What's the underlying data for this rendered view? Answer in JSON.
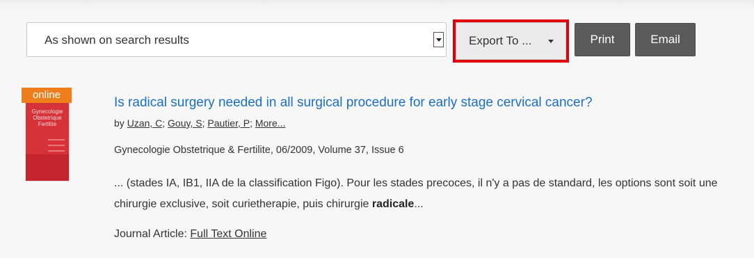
{
  "toolbar": {
    "select_value": "As shown on search results",
    "export_label": "Export To ...",
    "print_label": "Print",
    "email_label": "Email"
  },
  "result": {
    "badge": "online",
    "cover_text": "Gynecologie Obstetrique Fertilite",
    "title": "Is radical surgery needed in all surgical procedure for early stage cervical cancer?",
    "by": "by",
    "authors": [
      "Uzan, C",
      "Gouy, S",
      "Pautier, P",
      "More..."
    ],
    "publication": "Gynecologie Obstetrique & Fertilite, 06/2009, Volume 37, Issue 6",
    "snippet_text": "... (stades IA, IB1, IIA de la classification Figo). Pour les stades precoces, il n'y a pas de standard, les options sont soit une chirurgie exclusive, soit curietherapie, puis chirurgie ",
    "snippet_bold": "radicale",
    "snippet_end": "...",
    "type_label": "Journal Article:",
    "full_text_link": "Full Text Online"
  },
  "colors": {
    "highlight_border": "#e0000b",
    "badge": "#ee7d1c",
    "link": "#1a6fc2"
  }
}
